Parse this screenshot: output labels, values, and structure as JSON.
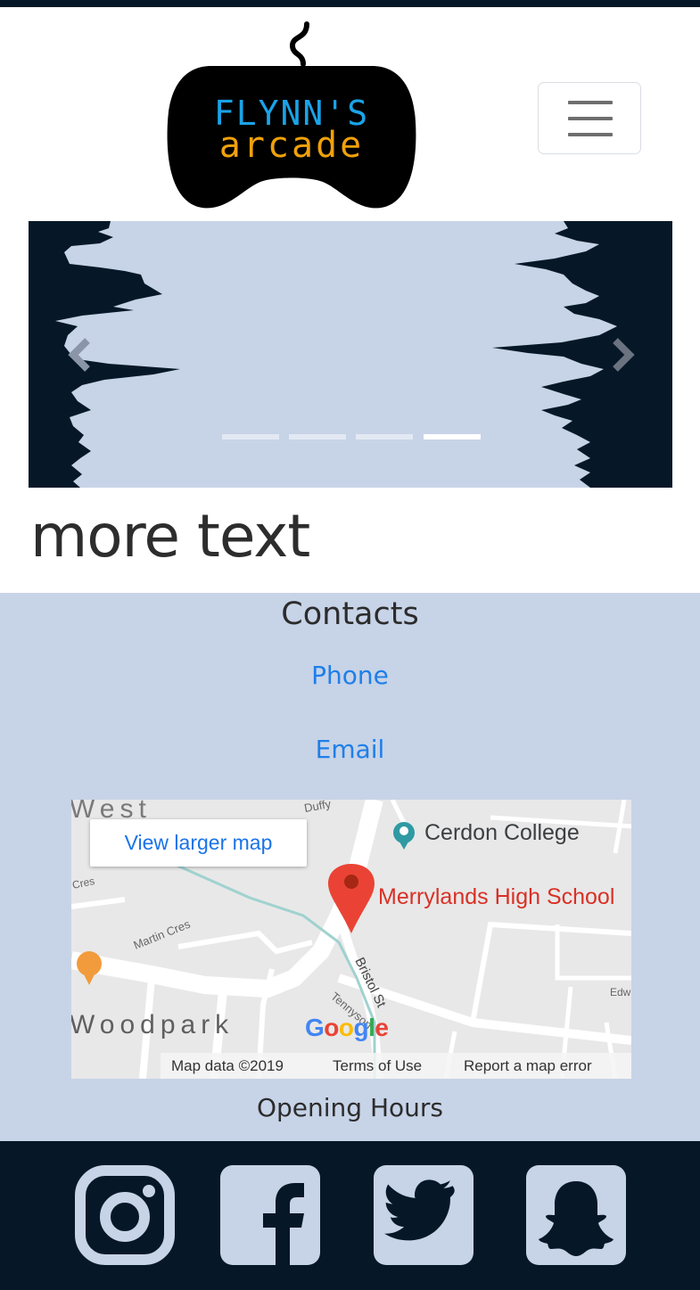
{
  "logo": {
    "line1": "FLYNN'S",
    "line2": "arcade"
  },
  "nav": {
    "menu_icon": "hamburger-icon"
  },
  "carousel": {
    "prev_icon": "chevron-left-icon",
    "next_icon": "chevron-right-icon",
    "slide_count": 4,
    "active_slide": 4
  },
  "main": {
    "heading": "more text"
  },
  "contacts": {
    "title": "Contacts",
    "phone_label": "Phone",
    "email_label": "Email",
    "opening_hours": "Opening Hours"
  },
  "map": {
    "view_larger": "View larger map",
    "college": "Cerdon College",
    "school": "Merrylands High School",
    "suburb_west": "West",
    "suburb_woodpark": "Woodpark",
    "street_martin": "Martin Cres",
    "street_bristol": "Bristol St",
    "street_tennyson": "Tennyson",
    "street_duffy": "Duffy",
    "street_cres": "Cres",
    "street_edw": "Edw",
    "google": "Google",
    "map_data": "Map data ©2019",
    "terms": "Terms of Use",
    "report": "Report a map error"
  },
  "social": [
    {
      "name": "instagram-icon"
    },
    {
      "name": "facebook-icon"
    },
    {
      "name": "twitter-icon"
    },
    {
      "name": "snapchat-icon"
    }
  ],
  "colors": {
    "dark": "#061827",
    "light_blue": "#c7d3e7",
    "link": "#1f7fe8",
    "logo_cyan": "#1aa3e8",
    "logo_orange": "#f0a10a"
  }
}
